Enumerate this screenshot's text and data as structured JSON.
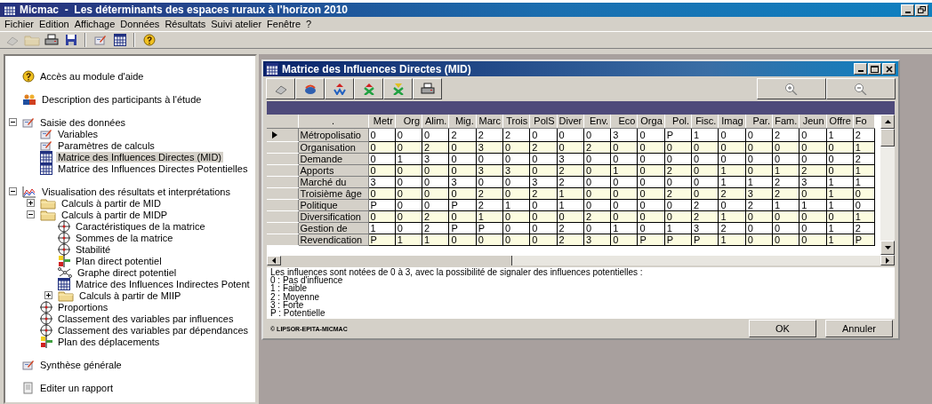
{
  "window": {
    "title": "Micmac  -  Les déterminants des espaces ruraux à l'horizon 2010"
  },
  "menu": [
    "Fichier",
    "Edition",
    "Affichage",
    "Données",
    "Résultats",
    "Suivi atelier",
    "Fenêtre",
    "?"
  ],
  "toolbar": [
    {
      "kind": "eraser",
      "disabled": true
    },
    {
      "kind": "folder",
      "disabled": true
    },
    {
      "kind": "printer",
      "disabled": false
    },
    {
      "kind": "save",
      "disabled": false
    },
    {
      "kind": "separator"
    },
    {
      "kind": "data",
      "disabled": false
    },
    {
      "kind": "matrix",
      "disabled": false
    },
    {
      "kind": "separator"
    },
    {
      "kind": "help",
      "disabled": false
    }
  ],
  "tree": [
    {
      "label": "Accès au module d'aide",
      "kind": "help",
      "selected": false
    },
    {
      "label": "Description des participants à l'étude",
      "kind": "people",
      "selected": false
    },
    {
      "label": "Saisie des données",
      "kind": "data",
      "selected": false,
      "expanded": true,
      "children": [
        {
          "label": "Variables",
          "kind": "data",
          "selected": false
        },
        {
          "label": "Paramètres de calculs",
          "kind": "data",
          "selected": false
        },
        {
          "label": "Matrice des Influences Directes (MID)",
          "kind": "matrix",
          "selected": true
        },
        {
          "label": "Matrice des Influences Directes Potentielles",
          "kind": "matrix",
          "selected": false
        }
      ]
    },
    {
      "label": "Visualisation des résultats et interprétations",
      "kind": "chart",
      "selected": false,
      "expanded": true,
      "children": [
        {
          "label": "Calculs à partir de MID",
          "kind": "folder",
          "selected": false,
          "expanded": false
        },
        {
          "label": "Calculs à partir de MIDP",
          "kind": "folder",
          "selected": false,
          "expanded": true,
          "children": [
            {
              "label": "Caractéristiques de la matrice",
              "kind": "target",
              "selected": false
            },
            {
              "label": "Sommes de la matrice",
              "kind": "target",
              "selected": false
            },
            {
              "label": "Stabilité",
              "kind": "target",
              "selected": false
            },
            {
              "label": "Plan direct potentiel",
              "kind": "plan",
              "selected": false
            },
            {
              "label": "Graphe direct potentiel",
              "kind": "graph",
              "selected": false
            },
            {
              "label": "Matrice des Influences Indirectes Potent",
              "kind": "matrix",
              "selected": false
            },
            {
              "label": "Calculs à partir de MIIP",
              "kind": "folder",
              "selected": false,
              "expanded": false
            }
          ]
        },
        {
          "label": "Proportions",
          "kind": "target",
          "selected": false
        },
        {
          "label": "Classement des variables par influences",
          "kind": "target",
          "selected": false
        },
        {
          "label": "Classement des variables par dépendances",
          "kind": "target",
          "selected": false
        },
        {
          "label": "Plan des déplacements",
          "kind": "plan",
          "selected": false
        }
      ]
    },
    {
      "label": "Synthèse générale",
      "kind": "data",
      "selected": false
    },
    {
      "label": "Editer un rapport",
      "kind": "report",
      "selected": false
    }
  ],
  "child_window": {
    "title": "Matrice des Influences Directes (MID)",
    "corner_label": ".",
    "columns": [
      "Metr",
      "Org",
      "Alim.",
      "Mig.",
      "Marc",
      "Trois",
      "PolS",
      "Diver",
      "Env.",
      "Eco",
      "Orga",
      "Pol.",
      "Fisc.",
      "Imag",
      "Par.",
      "Fam.",
      "Jeun",
      "Offre",
      "Fo"
    ],
    "rows": [
      {
        "label": "Métropolisatio",
        "selected": true,
        "cells": [
          "0",
          "0",
          "0",
          "2",
          "2",
          "2",
          "0",
          "0",
          "0",
          "3",
          "0",
          "P",
          "1",
          "0",
          "0",
          "2",
          "0",
          "1",
          "2"
        ]
      },
      {
        "label": "Organisation",
        "selected": false,
        "cells": [
          "0",
          "0",
          "2",
          "0",
          "3",
          "0",
          "2",
          "0",
          "2",
          "0",
          "0",
          "0",
          "0",
          "0",
          "0",
          "0",
          "0",
          "0",
          "1"
        ]
      },
      {
        "label": "Demande",
        "selected": false,
        "cells": [
          "0",
          "1",
          "3",
          "0",
          "0",
          "0",
          "0",
          "3",
          "0",
          "0",
          "0",
          "0",
          "0",
          "0",
          "0",
          "0",
          "0",
          "0",
          "2"
        ]
      },
      {
        "label": "Apports",
        "selected": false,
        "cells": [
          "0",
          "0",
          "0",
          "0",
          "3",
          "3",
          "0",
          "2",
          "0",
          "1",
          "0",
          "2",
          "0",
          "1",
          "0",
          "1",
          "2",
          "0",
          "1"
        ]
      },
      {
        "label": "Marché du",
        "selected": false,
        "cells": [
          "3",
          "0",
          "0",
          "3",
          "0",
          "0",
          "3",
          "2",
          "0",
          "0",
          "0",
          "0",
          "0",
          "1",
          "1",
          "2",
          "3",
          "1",
          "1"
        ]
      },
      {
        "label": "Troisième âge",
        "selected": false,
        "cells": [
          "0",
          "0",
          "0",
          "0",
          "2",
          "0",
          "2",
          "1",
          "0",
          "0",
          "0",
          "2",
          "0",
          "2",
          "3",
          "2",
          "0",
          "1",
          "0"
        ]
      },
      {
        "label": "Politique",
        "selected": false,
        "cells": [
          "P",
          "0",
          "0",
          "P",
          "2",
          "1",
          "0",
          "1",
          "0",
          "0",
          "0",
          "0",
          "2",
          "0",
          "2",
          "1",
          "1",
          "1",
          "0"
        ]
      },
      {
        "label": "Diversification",
        "selected": false,
        "cells": [
          "0",
          "0",
          "2",
          "0",
          "1",
          "0",
          "0",
          "0",
          "2",
          "0",
          "0",
          "0",
          "2",
          "1",
          "0",
          "0",
          "0",
          "0",
          "1"
        ]
      },
      {
        "label": "Gestion de",
        "selected": false,
        "cells": [
          "1",
          "0",
          "2",
          "P",
          "P",
          "0",
          "0",
          "2",
          "0",
          "1",
          "0",
          "1",
          "3",
          "2",
          "0",
          "0",
          "0",
          "1",
          "2"
        ]
      },
      {
        "label": "Revendication",
        "selected": false,
        "cells": [
          "P",
          "1",
          "1",
          "0",
          "0",
          "0",
          "0",
          "2",
          "3",
          "0",
          "P",
          "P",
          "P",
          "1",
          "0",
          "0",
          "0",
          "1",
          "P"
        ]
      }
    ],
    "legend": [
      "Les influences sont notées de 0 à 3, avec la possibilité de signaler des influences potentielles :",
      "0 : Pas d'influence",
      "1 : Faible",
      "2 : Moyenne",
      "3 : Forte",
      "P : Potentielle"
    ],
    "copyright": "© LIPSOR-EPITA-MICMAC",
    "buttons": [
      "OK",
      "Annuler"
    ]
  }
}
